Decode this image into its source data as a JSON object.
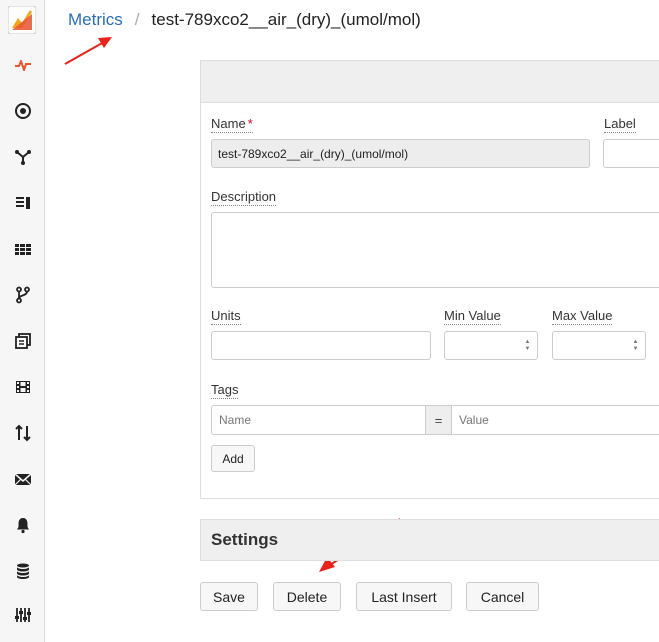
{
  "breadcrumb": {
    "parent": "Metrics",
    "separator": "/",
    "current": "test-789xco2__air_(dry)_(umol/mol)"
  },
  "sidebar": {
    "items": [
      {
        "icon": "activity-icon",
        "active": true
      },
      {
        "icon": "target-icon"
      },
      {
        "icon": "graph-icon"
      },
      {
        "icon": "dashboard-icon"
      },
      {
        "icon": "grid-icon"
      },
      {
        "icon": "branch-icon"
      },
      {
        "icon": "copy-icon"
      },
      {
        "icon": "film-icon"
      },
      {
        "icon": "transfer-icon"
      },
      {
        "icon": "mail-icon"
      },
      {
        "icon": "bell-icon"
      },
      {
        "icon": "database-icon"
      },
      {
        "icon": "sliders-icon"
      }
    ]
  },
  "form": {
    "name_label": "Name",
    "required_marker": "*",
    "name_value": "test-789xco2__air_(dry)_(umol/mol)",
    "label_label": "Label",
    "label_value": "",
    "description_label": "Description",
    "description_value": "",
    "units_label": "Units",
    "units_value": "",
    "min_label": "Min Value",
    "min_value": "",
    "max_label": "Max Value",
    "max_value": "",
    "tags_label": "Tags",
    "tag_name_placeholder": "Name",
    "tag_equals": "=",
    "tag_value_placeholder": "Value",
    "add_label": "Add"
  },
  "settings": {
    "title": "Settings"
  },
  "actions": {
    "save": "Save",
    "delete": "Delete",
    "last_insert": "Last Insert",
    "cancel": "Cancel"
  },
  "colors": {
    "link": "#2a6db5",
    "accent": "#e8542f",
    "required": "#d0021b",
    "annotation": "#e8231a"
  }
}
